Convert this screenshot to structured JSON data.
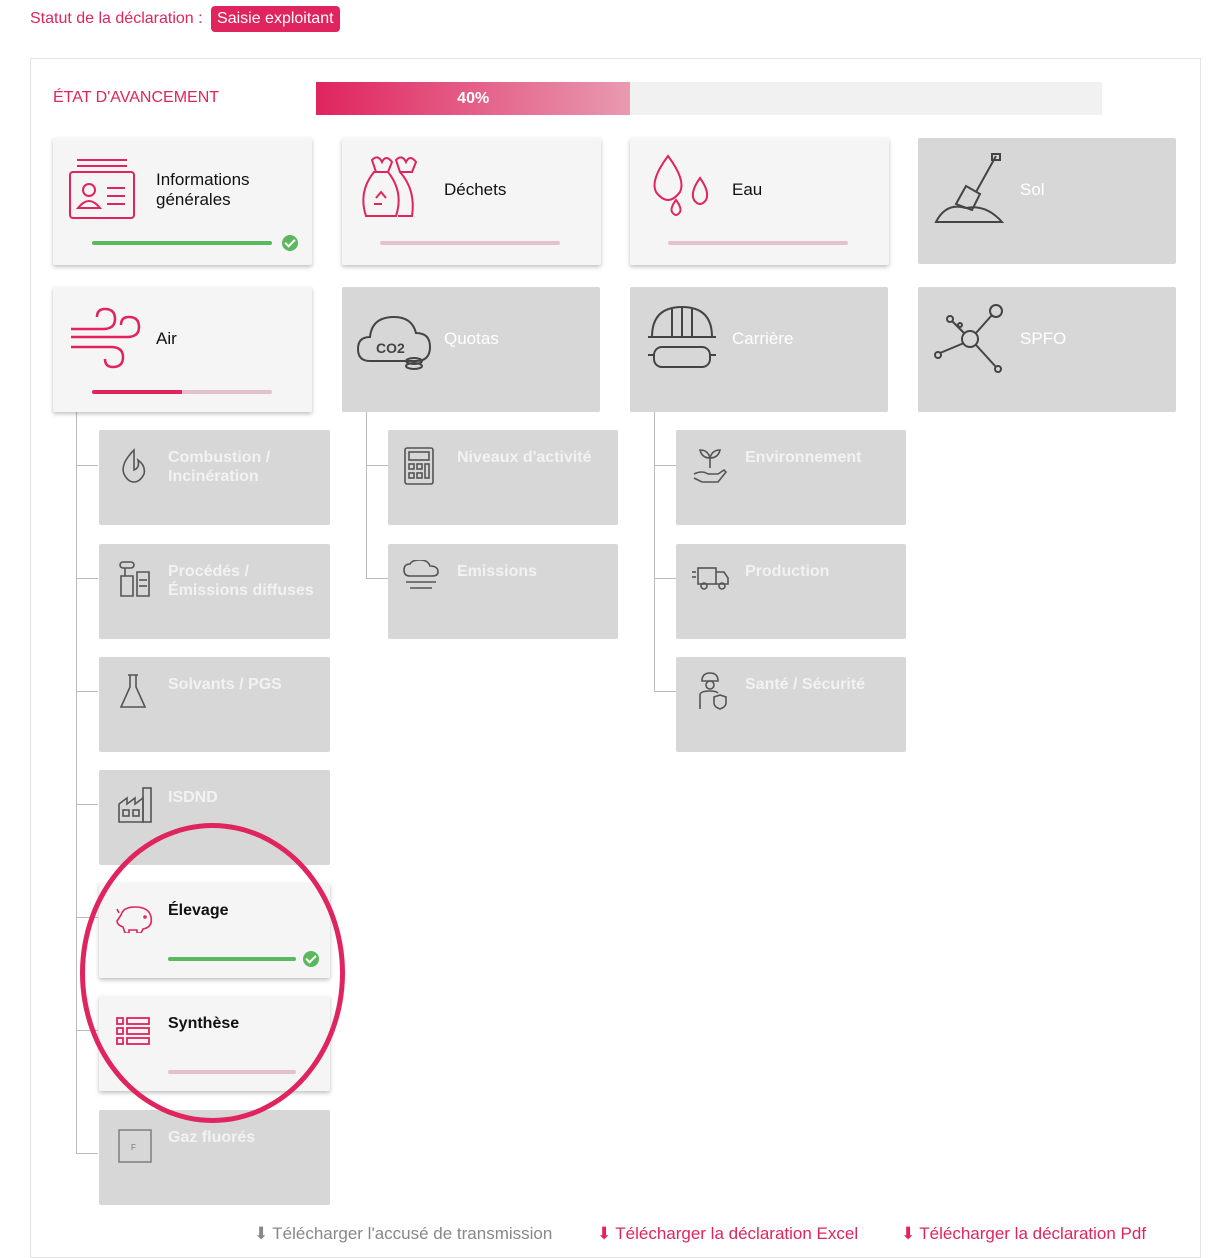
{
  "status": {
    "label": "Statut de la déclaration :",
    "badge": "Saisie exploitant"
  },
  "progress": {
    "label": "ÉTAT D'AVANCEMENT",
    "value_text": "40%",
    "percent": 40
  },
  "cards": {
    "info": {
      "label": "Informations générales",
      "progress": 1.0,
      "done": true
    },
    "dechets": {
      "label": "Déchets",
      "progress": 0.0
    },
    "eau": {
      "label": "Eau",
      "progress": 0.0
    },
    "sol": {
      "label": "Sol"
    },
    "air": {
      "label": "Air",
      "progress": 0.5
    },
    "quotas": {
      "label": "Quotas"
    },
    "carriere": {
      "label": "Carrière"
    },
    "spfo": {
      "label": "SPFO"
    }
  },
  "air_sub": {
    "combustion": "Combustion / Incinération",
    "procedes": "Procédés / Émissions diffuses",
    "solvants": "Solvants / PGS",
    "isdnd": "ISDND",
    "elevage": {
      "label": "Élevage",
      "progress": 1.0,
      "done": true
    },
    "synthese": {
      "label": "Synthèse",
      "progress": 0.0
    },
    "gaz": "Gaz fluorés"
  },
  "quotas_sub": {
    "niveaux": "Niveaux d'activité",
    "emissions": "Emissions"
  },
  "carriere_sub": {
    "environnement": "Environnement",
    "production": "Production",
    "sante": "Santé / Sécurité"
  },
  "downloads": {
    "accuse": "Télécharger l'accusé de transmission",
    "excel": "Télécharger la déclaration Excel",
    "pdf": "Télécharger la déclaration Pdf"
  },
  "colors": {
    "accent": "#e0245e",
    "done": "#5cb85c",
    "inactive": "#d7d7d7"
  }
}
